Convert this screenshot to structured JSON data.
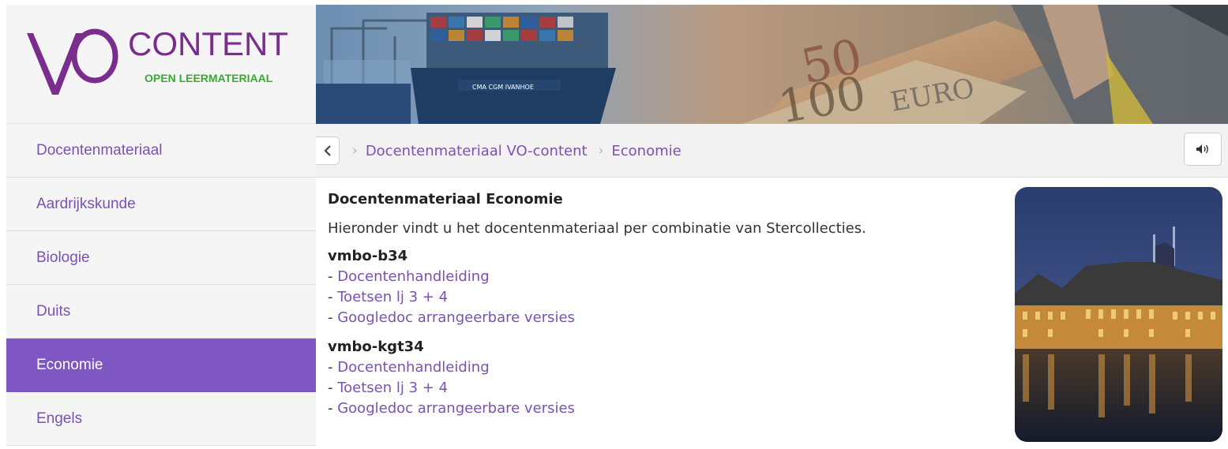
{
  "logo": {
    "brand_initials": "VO",
    "brand_word": "CONTENT",
    "tagline": "OPEN LEERMATERIAAL",
    "colors": {
      "purple": "#7b2d8e",
      "green": "#3aa935"
    }
  },
  "sidebar": {
    "items": [
      {
        "label": "Docentenmateriaal",
        "active": false
      },
      {
        "label": "Aardrijkskunde",
        "active": false
      },
      {
        "label": "Biologie",
        "active": false
      },
      {
        "label": "Duits",
        "active": false
      },
      {
        "label": "Economie",
        "active": true
      },
      {
        "label": "Engels",
        "active": false
      }
    ]
  },
  "banner": {
    "description_icons": [
      "container-ship-image",
      "euro-banknotes-image",
      "businessman-image"
    ]
  },
  "breadcrumb": {
    "back_icon": "chevron-left-icon",
    "separator_icon": "chevron-right-icon",
    "items": [
      "Docentenmateriaal VO-content",
      "Economie"
    ],
    "audio_icon": "speaker-icon"
  },
  "content": {
    "title": "Docentenmateriaal Economie",
    "intro": "Hieronder vindt u het docentenmateriaal per combinatie van Stercollecties.",
    "sections": [
      {
        "heading": "vmbo-b34",
        "links": [
          "Docentenhandleiding",
          "Toetsen lj 3 + 4",
          "Googledoc arrangeerbare versies"
        ]
      },
      {
        "heading": "vmbo-kgt34",
        "links": [
          "Docentenhandleiding",
          "Toetsen lj 3 + 4",
          "Googledoc arrangeerbare versies"
        ]
      }
    ],
    "link_prefix": "- "
  },
  "theme": {
    "accent": "#7e57c2",
    "link": "#7a52b3"
  }
}
